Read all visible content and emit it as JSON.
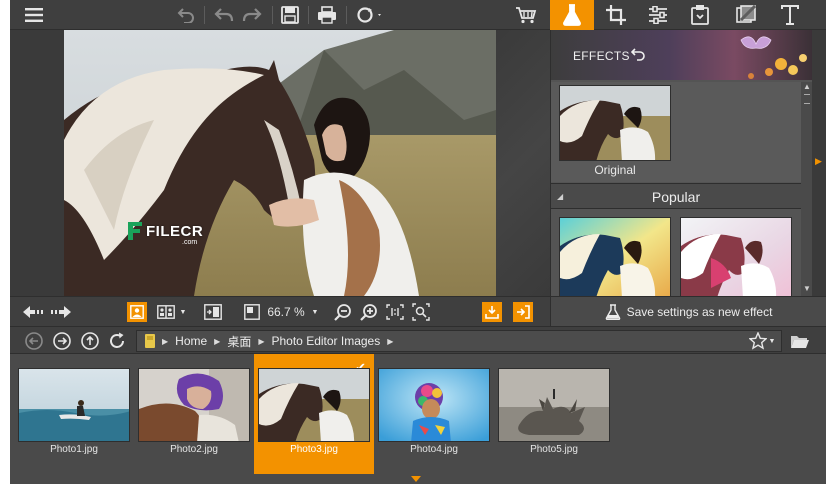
{
  "toolbar": {
    "icons": [
      "menu-icon",
      "undo-icon",
      "undo-step-icon",
      "redo-step-icon",
      "save-icon",
      "print-icon",
      "share-icon",
      "shopping-cart-icon"
    ],
    "tabs": [
      "effects-flask-icon",
      "crop-icon",
      "adjust-sliders-icon",
      "retouch-icon",
      "frames-icon",
      "text-icon"
    ],
    "active_tab": "effects-flask-icon",
    "accent_color": "#f39200"
  },
  "canvas": {
    "watermark_text": "FILECR",
    "watermark_sub": ".com"
  },
  "image_toolbar": {
    "zoom_value": "66.7 %"
  },
  "effects_panel": {
    "header_label": "EFFECTS",
    "original_caption": "Original",
    "section_label": "Popular"
  },
  "save_effect": {
    "label": "Save settings as new effect"
  },
  "browser": {
    "path": [
      "Home",
      "桌面",
      "Photo Editor Images"
    ]
  },
  "thumbnails": [
    {
      "caption": "Photo1.jpg",
      "selected": false
    },
    {
      "caption": "Photo2.jpg",
      "selected": false
    },
    {
      "caption": "Photo3.jpg",
      "selected": true
    },
    {
      "caption": "Photo4.jpg",
      "selected": false
    },
    {
      "caption": "Photo5.jpg",
      "selected": false
    }
  ]
}
